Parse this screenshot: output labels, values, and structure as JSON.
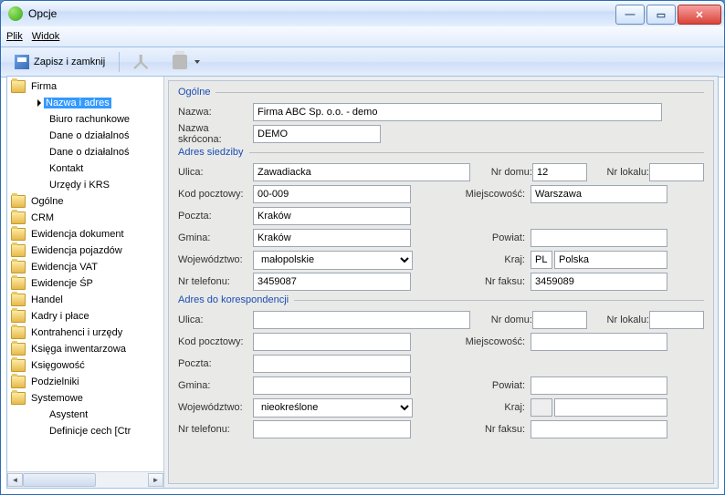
{
  "window": {
    "title": "Opcje"
  },
  "menu": {
    "file": "Plik",
    "view": "Widok"
  },
  "toolbar": {
    "save_close": "Zapisz i zamknij"
  },
  "tree": {
    "root": "Firma",
    "firma_children": [
      "Nazwa i adres",
      "Biuro rachunkowe",
      "Dane o działalnoś",
      "Dane o działalnoś",
      "Kontakt",
      "Urzędy i KRS"
    ],
    "others": [
      "Ogólne",
      "CRM",
      "Ewidencja dokument",
      "Ewidencja pojazdów",
      "Ewidencja VAT",
      "Ewidencje ŚP",
      "Handel",
      "Kadry i płace",
      "Kontrahenci i urzędy",
      "Księga inwentarzowa",
      "Księgowość",
      "Podzielniki",
      "Systemowe"
    ],
    "sys_children": [
      "Asystent",
      "Definicje cech [Ctr"
    ]
  },
  "groups": {
    "ogolne": "Ogólne",
    "siedziba": "Adres siedziby",
    "koresp": "Adres do korespondencji"
  },
  "labels": {
    "nazwa": "Nazwa:",
    "nazwa_skr": "Nazwa skrócona:",
    "ulica": "Ulica:",
    "nrdomu": "Nr domu:",
    "nrlok": "Nr lokalu:",
    "kod": "Kod pocztowy:",
    "miejsc": "Miejscowość:",
    "poczta": "Poczta:",
    "gmina": "Gmina:",
    "powiat": "Powiat:",
    "woj": "Województwo:",
    "kraj": "Kraj:",
    "tel": "Nr telefonu:",
    "faks": "Nr faksu:"
  },
  "values": {
    "nazwa": "Firma ABC Sp. o.o. - demo",
    "nazwa_skr": "DEMO",
    "s_ulica": "Zawadiacka",
    "s_nrdomu": "12",
    "s_nrlok": "",
    "s_kod": "00-009",
    "s_miejsc": "Warszawa",
    "s_poczta": "Kraków",
    "s_gmina": "Kraków",
    "s_powiat": "",
    "s_woj": "małopolskie",
    "s_kraj_code": "PL",
    "s_kraj": "Polska",
    "s_tel": "3459087",
    "s_faks": "3459089",
    "k_ulica": "",
    "k_nrdomu": "",
    "k_nrlok": "",
    "k_kod": "",
    "k_miejsc": "",
    "k_poczta": "",
    "k_gmina": "",
    "k_powiat": "",
    "k_woj": "nieokreślone",
    "k_kraj_code": "",
    "k_kraj": "",
    "k_tel": "",
    "k_faks": ""
  }
}
